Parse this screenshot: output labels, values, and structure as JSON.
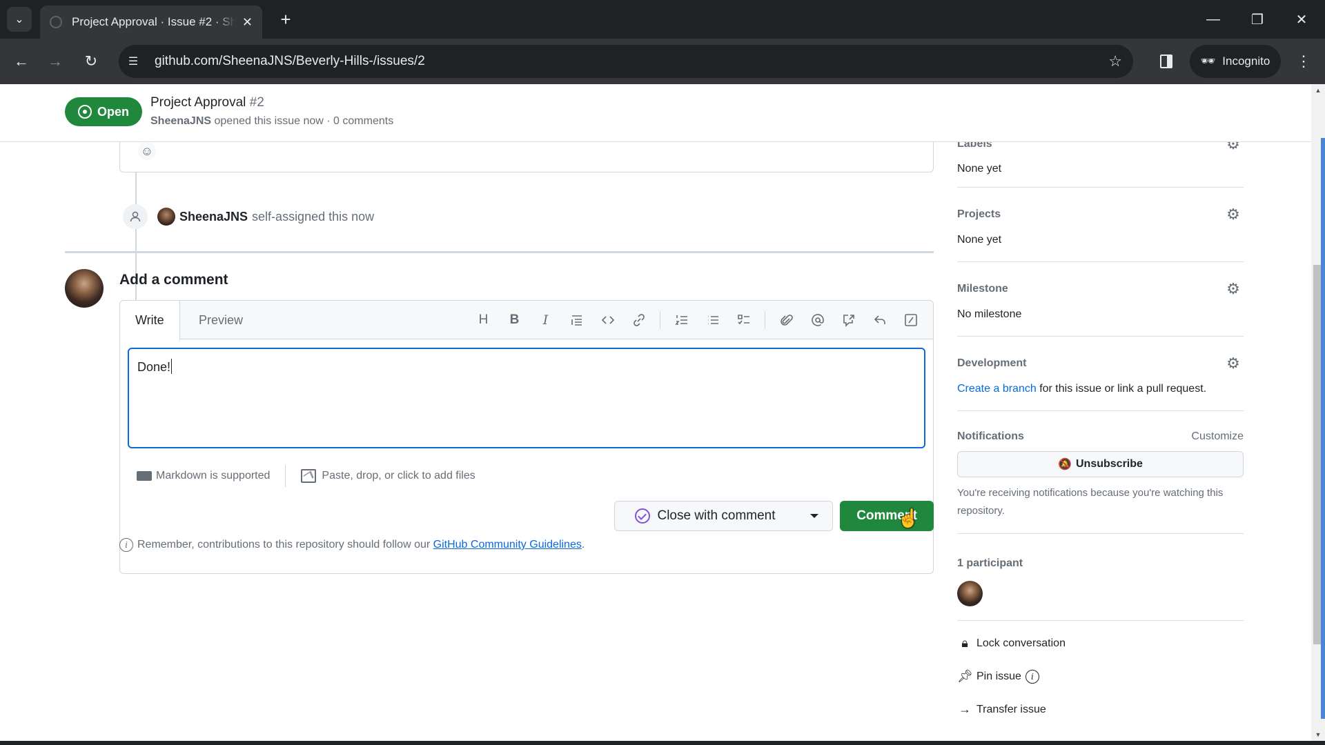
{
  "browser": {
    "tab_title": "Project Approval · Issue #2 · SheenaJNS/Beverly-Hills-",
    "url": "github.com/SheenaJNS/Beverly-Hills-/issues/2",
    "incognito_label": "Incognito"
  },
  "issue": {
    "status": "Open",
    "title": "Project Approval",
    "number": "#2",
    "author": "SheenaJNS",
    "meta_text": "opened this issue now · 0 comments"
  },
  "timeline": {
    "event_user": "SheenaJNS",
    "event_text": "self-assigned this now"
  },
  "comment_form": {
    "heading": "Add a comment",
    "tabs": [
      "Write",
      "Preview"
    ],
    "active_tab": "Write",
    "toolbar": [
      {
        "icon": "heading-icon",
        "label": "Heading"
      },
      {
        "icon": "bold-icon",
        "label": "Bold"
      },
      {
        "icon": "italic-icon",
        "label": "Italic"
      },
      {
        "icon": "quote-icon",
        "label": "Quote"
      },
      {
        "icon": "code-icon",
        "label": "Code"
      },
      {
        "icon": "link-icon",
        "label": "Link"
      },
      {
        "icon": "numbered-list-icon",
        "label": "Numbered list"
      },
      {
        "icon": "unordered-list-icon",
        "label": "Unordered list"
      },
      {
        "icon": "task-list-icon",
        "label": "Task list"
      },
      {
        "icon": "attach-icon",
        "label": "Attach files"
      },
      {
        "icon": "mention-icon",
        "label": "Mention"
      },
      {
        "icon": "reference-icon",
        "label": "Reference"
      },
      {
        "icon": "reply-icon",
        "label": "Saved replies"
      },
      {
        "icon": "slash-commands-icon",
        "label": "Slash commands"
      }
    ],
    "text_value": "Done!",
    "markdown_note": "Markdown is supported",
    "files_note": "Paste, drop, or click to add files",
    "close_button": "Close with comment",
    "comment_button": "Comment",
    "guidelines_prefix": "Remember, contributions to this repository should follow our",
    "guidelines_link": "GitHub Community Guidelines",
    "guidelines_suffix": "."
  },
  "sidebar": {
    "labels": {
      "heading": "Labels",
      "value": "None yet"
    },
    "projects": {
      "heading": "Projects",
      "value": "None yet"
    },
    "milestone": {
      "heading": "Milestone",
      "value": "No milestone"
    },
    "development": {
      "heading": "Development",
      "link": "Create a branch",
      "text": "for this issue or link a pull request."
    },
    "notifications": {
      "heading": "Notifications",
      "customize": "Customize",
      "button": "Unsubscribe",
      "note": "You're receiving notifications because you're watching this repository."
    },
    "participants": {
      "heading": "1 participant"
    },
    "actions": {
      "lock": "Lock conversation",
      "pin": "Pin issue",
      "transfer": "Transfer issue"
    }
  },
  "colors": {
    "open_green": "#1f883d",
    "link_blue": "#0969da",
    "close_purple": "#8250df"
  }
}
